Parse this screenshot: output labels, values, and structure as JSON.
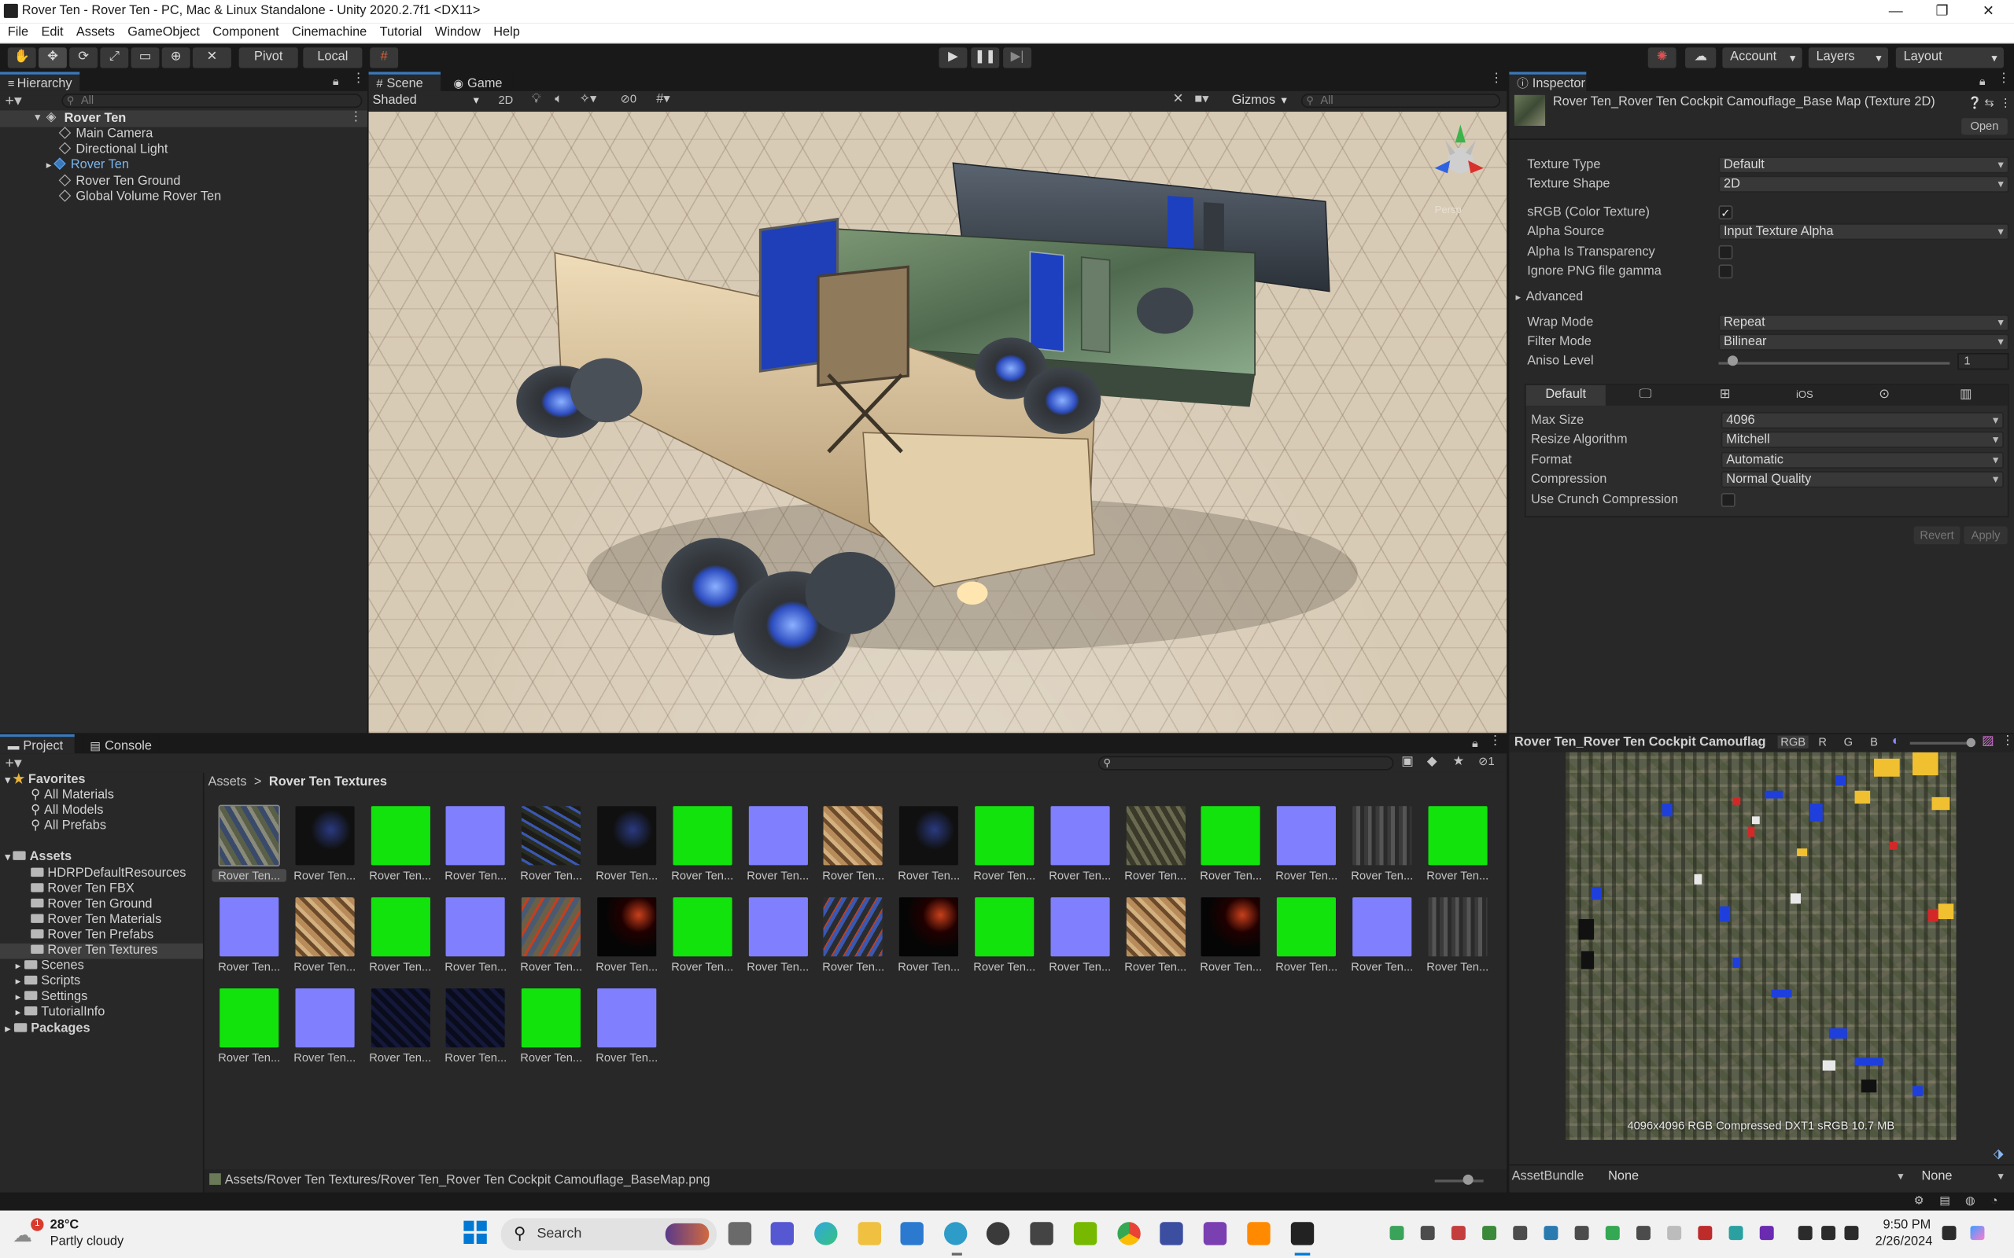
{
  "window": {
    "title": "Rover Ten - Rover Ten - PC, Mac & Linux Standalone - Unity 2020.2.7f1 <DX11>",
    "min": "—",
    "max": "❐",
    "close": "✕"
  },
  "menu": [
    "File",
    "Edit",
    "Assets",
    "GameObject",
    "Component",
    "Cinemachine",
    "Tutorial",
    "Window",
    "Help"
  ],
  "toolbar": {
    "pivot": "Pivot",
    "local": "Local",
    "play": "▶",
    "pause": "❚❚",
    "step": "▶|",
    "account": "Account",
    "layers": "Layers",
    "layout": "Layout"
  },
  "hierarchy": {
    "tab": "Hierarchy",
    "search_placeholder": "All",
    "scene": "Rover Ten",
    "items": [
      "Main Camera",
      "Directional Light",
      "Rover Ten",
      "Rover Ten Ground",
      "Global Volume Rover Ten"
    ]
  },
  "scene": {
    "tab_scene": "Scene",
    "tab_game": "Game",
    "shading": "Shaded",
    "mode2d": "2D",
    "hidden_count": "0",
    "gizmos": "Gizmos",
    "search_placeholder": "All",
    "persp_label": "Persp"
  },
  "inspector": {
    "tab": "Inspector",
    "asset_title": "Rover Ten_Rover Ten Cockpit Camouflage_Base Map (Texture 2D)",
    "open_button": "Open",
    "fields": [
      {
        "label": "Texture Type",
        "value": "Default"
      },
      {
        "label": "Texture Shape",
        "value": "2D"
      }
    ],
    "srgb_label": "sRGB (Color Texture)",
    "alpha_source_label": "Alpha Source",
    "alpha_source_value": "Input Texture Alpha",
    "alpha_transparency_label": "Alpha Is Transparency",
    "ignore_png_label": "Ignore PNG file gamma",
    "advanced_label": "Advanced",
    "wrap_mode_label": "Wrap Mode",
    "wrap_mode_value": "Repeat",
    "filter_mode_label": "Filter Mode",
    "filter_mode_value": "Bilinear",
    "aniso_label": "Aniso Level",
    "aniso_value": "1",
    "aniso_level": 1,
    "platform_default": "Default",
    "platform_ios": "iOS",
    "max_size_label": "Max Size",
    "max_size_value": "4096",
    "resize_label": "Resize Algorithm",
    "resize_value": "Mitchell",
    "format_label": "Format",
    "format_value": "Automatic",
    "compression_label": "Compression",
    "compression_value": "Normal Quality",
    "crunch_label": "Use Crunch Compression",
    "revert": "Revert",
    "apply": "Apply"
  },
  "project": {
    "tab_project": "Project",
    "tab_console": "Console",
    "favorites": "Favorites",
    "favorite_items": [
      "All Materials",
      "All Models",
      "All Prefabs"
    ],
    "assets": "Assets",
    "asset_folders": [
      "HDRPDefaultResources",
      "Rover Ten FBX",
      "Rover Ten Ground",
      "Rover Ten Materials",
      "Rover Ten Prefabs",
      "Rover Ten Textures",
      "Scenes",
      "Scripts",
      "Settings",
      "TutorialInfo"
    ],
    "packages": "Packages",
    "breadcrumb_root": "Assets",
    "breadcrumb_sep": ">",
    "breadcrumb_current": "Rover Ten Textures",
    "hidden_count": "1",
    "thumb_label": "Rover Ten...",
    "thumbnails": [
      [
        "camo",
        "dark",
        "green",
        "blue",
        "camodark",
        "dark",
        "green",
        "blue",
        "sand",
        "dark",
        "green",
        "blue",
        "olive",
        "green",
        "blue",
        "grey",
        "green"
      ],
      [
        "blue",
        "sand",
        "green",
        "blue",
        "camorust",
        "darkred",
        "green",
        "blue",
        "darkrust",
        "darkred",
        "green",
        "blue",
        "sand",
        "darkred",
        "green",
        "blue",
        "grey"
      ],
      [
        "green",
        "blue",
        "darknavy",
        "darknavy",
        "green",
        "blue"
      ]
    ],
    "status_path": "Assets/Rover Ten Textures/Rover Ten_Rover Ten Cockpit Camouflage_BaseMap.png"
  },
  "preview": {
    "title": "Rover Ten_Rover Ten Cockpit Camouflag",
    "channels": [
      "RGB",
      "R",
      "G",
      "B"
    ],
    "info": "4096x4096  RGB Compressed DXT1 sRGB  10.7 MB",
    "assetbundle_label": "AssetBundle",
    "assetbundle_value": "None",
    "variant_value": "None"
  },
  "taskbar": {
    "weather_temp": "28°C",
    "weather_desc": "Partly cloudy",
    "badge": "1",
    "search_label": "Search",
    "time": "9:50 PM",
    "date": "2/26/2024"
  },
  "colors": {
    "accent": "#3a79bb",
    "green_texture": "#12e30d",
    "normal_texture": "#8080ff",
    "selected_item": "#2c5d87"
  }
}
